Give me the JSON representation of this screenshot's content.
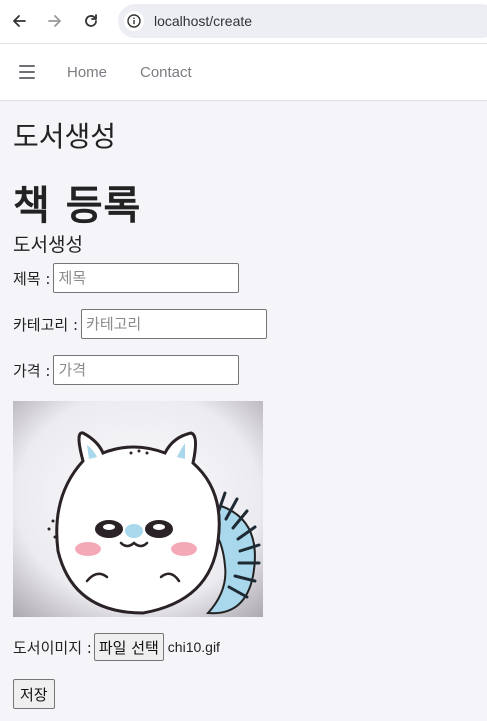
{
  "browser": {
    "url": "localhost/create",
    "icons": {
      "back": "arrow-left-icon",
      "forward": "arrow-right-icon",
      "reload": "reload-icon",
      "site_info": "info-icon"
    }
  },
  "navbar": {
    "menu_icon": "hamburger-icon",
    "links": [
      "Home",
      "Contact"
    ]
  },
  "page": {
    "title": "도서생성",
    "heading": "책 등록",
    "subheading": "도서생성"
  },
  "form": {
    "title": {
      "label": "제목 :",
      "placeholder": "제목",
      "value": ""
    },
    "category": {
      "label": "카테고리 :",
      "placeholder": "카테고리",
      "value": ""
    },
    "price": {
      "label": "가격 :",
      "placeholder": "가격",
      "value": ""
    },
    "image": {
      "label": "도서이미지 :",
      "button_label": "파일 선택",
      "file_name": "chi10.gif"
    },
    "save_label": "저장"
  },
  "colors": {
    "page_bg": "#f4f4f9",
    "nav_link": "#7c7c83",
    "preview_accent": "#a9d8ec",
    "preview_blush": "#f3aab6"
  }
}
